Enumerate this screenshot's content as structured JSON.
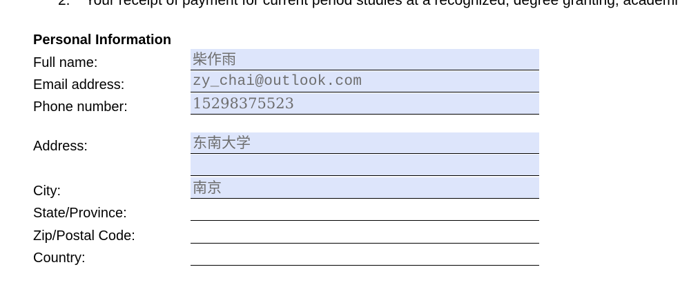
{
  "clipped_text": {
    "number": "2.",
    "text": "Your receipt of payment for current period studies at a recognized, degree granting, academi"
  },
  "section": {
    "title": "Personal Information"
  },
  "fields": {
    "full_name": {
      "label": "Full name:",
      "value": "柴作雨"
    },
    "email": {
      "label": "Email address:",
      "value": "zy_chai@outlook.com"
    },
    "phone": {
      "label": "Phone number:",
      "value": "15298375523"
    },
    "address": {
      "label": "Address:",
      "value": "东南大学",
      "value_line2": ""
    },
    "city": {
      "label": "City:",
      "value": "南京"
    },
    "state": {
      "label": "State/Province:",
      "value": ""
    },
    "zip": {
      "label": "Zip/Postal Code:",
      "value": ""
    },
    "country": {
      "label": "Country:",
      "value": ""
    }
  },
  "colors": {
    "field_fill": "#dde5fb",
    "field_text": "#6e6e6e"
  }
}
